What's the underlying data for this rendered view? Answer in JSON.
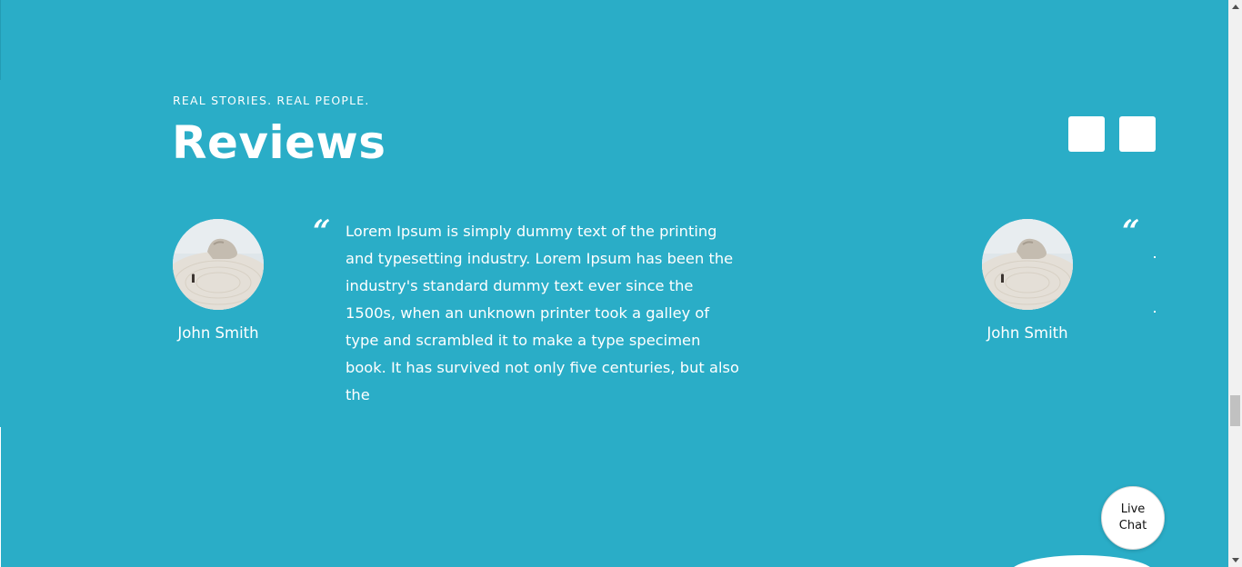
{
  "section": {
    "eyebrow": "REAL STORIES. REAL PEOPLE.",
    "title": "Reviews"
  },
  "carousel": {
    "prev_button": "",
    "next_button": ""
  },
  "reviews": [
    {
      "name": "John Smith",
      "quote_mark": "“",
      "text": "Lorem Ipsum is simply dummy text of the printing and typesetting industry. Lorem Ipsum has been the industry's standard dummy text ever since the 1500s, when an unknown printer took a galley of type and scrambled it to make a type specimen book. It has survived not only five centuries, but also the"
    },
    {
      "name": "John Smith",
      "quote_mark": "“",
      "text": ""
    }
  ],
  "live_chat": {
    "label": "Live Chat"
  },
  "colors": {
    "background": "#2aadc7",
    "text": "#ffffff",
    "button": "#ffffff"
  }
}
